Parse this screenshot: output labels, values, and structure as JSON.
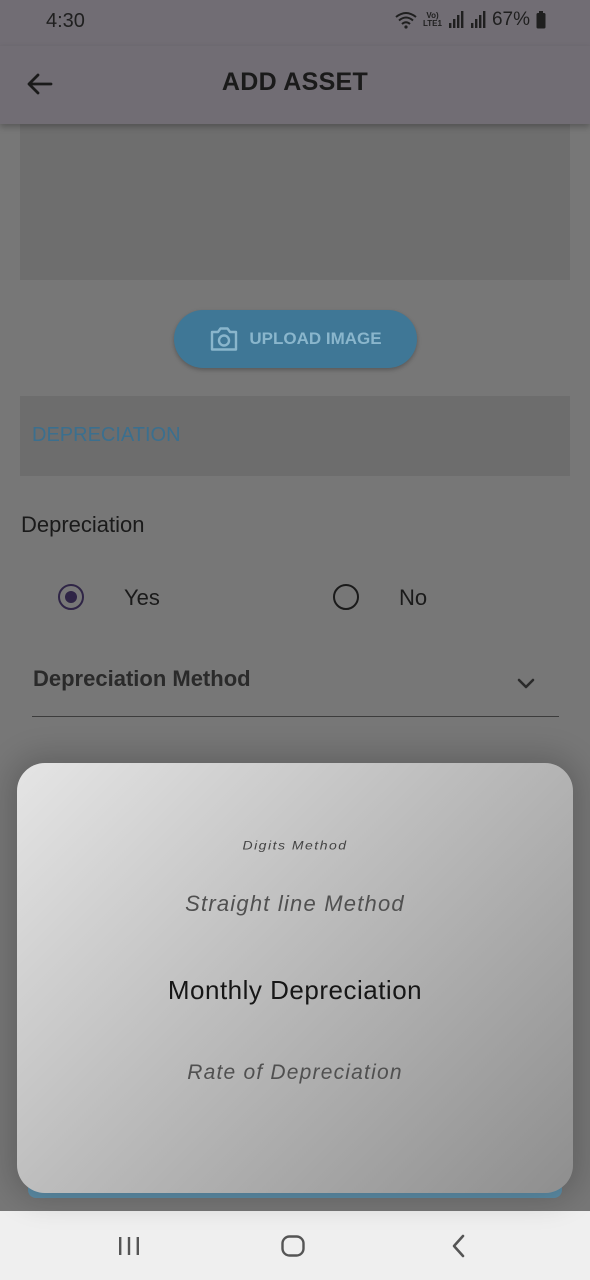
{
  "status_bar": {
    "time": "4:30",
    "battery_percent": "67%",
    "network_label_top": "Vo)",
    "network_label_bottom": "LTE1"
  },
  "app_bar": {
    "title": "ADD ASSET",
    "back_icon": "arrow-left-icon"
  },
  "upload": {
    "label": "UPLOAD IMAGE",
    "icon": "camera-icon"
  },
  "section": {
    "title": "DEPRECIATION"
  },
  "depreciation": {
    "label": "Depreciation",
    "options": [
      {
        "label": "Yes",
        "selected": true
      },
      {
        "label": "No",
        "selected": false
      }
    ]
  },
  "method_dropdown": {
    "label": "Depreciation Method",
    "icon": "chevron-down-icon"
  },
  "picker": {
    "items": [
      "Digits Method",
      "Straight line Method",
      "Monthly Depreciation",
      "Rate of Depreciation"
    ],
    "selected_index": 2
  },
  "nav_bar": {
    "recents_icon": "recents-icon",
    "home_icon": "home-icon",
    "back_icon": "back-chevron-icon"
  },
  "colors": {
    "accent": "#3f7796",
    "radio_selected": "#2f2546",
    "scrim_background": "#777777"
  }
}
